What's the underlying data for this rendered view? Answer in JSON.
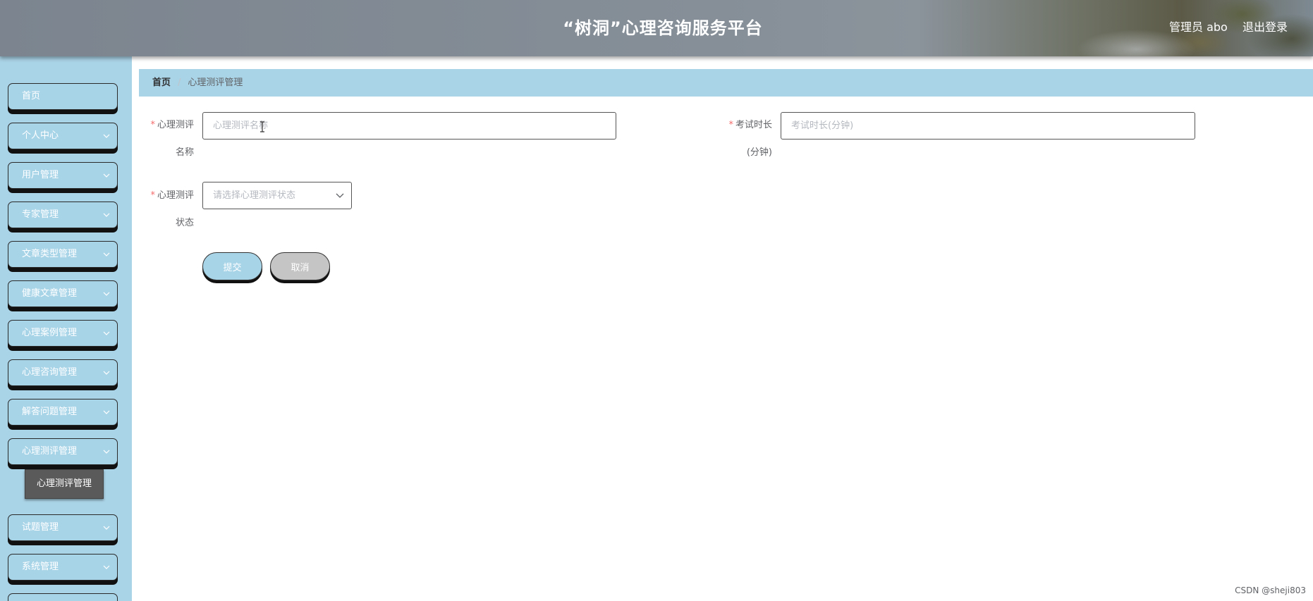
{
  "header": {
    "title": "“树洞”心理咨询服务平台",
    "user_label": "管理员 abo",
    "logout_label": "退出登录"
  },
  "sidebar": {
    "items": [
      {
        "label": "首页",
        "has_chevron": false
      },
      {
        "label": "个人中心",
        "has_chevron": true
      },
      {
        "label": "用户管理",
        "has_chevron": true
      },
      {
        "label": "专家管理",
        "has_chevron": true
      },
      {
        "label": "文章类型管理",
        "has_chevron": true
      },
      {
        "label": "健康文章管理",
        "has_chevron": true
      },
      {
        "label": "心理案例管理",
        "has_chevron": true
      },
      {
        "label": "心理咨询管理",
        "has_chevron": true
      },
      {
        "label": "解答问题管理",
        "has_chevron": true
      },
      {
        "label": "心理测评管理",
        "has_chevron": true,
        "expanded": true
      },
      {
        "label": "试题管理",
        "has_chevron": true
      },
      {
        "label": "系统管理",
        "has_chevron": true
      },
      {
        "label": "",
        "has_chevron": false
      }
    ],
    "active_sub_item": "心理测评管理"
  },
  "breadcrumb": {
    "home": "首页",
    "separator": "/",
    "current": "心理测评管理"
  },
  "form": {
    "name_label_line1": "心理测评",
    "name_label_line2": "名称",
    "name_placeholder": "心理测评名称",
    "name_value": "",
    "duration_label_line1": "考试时长",
    "duration_label_line2": "(分钟)",
    "duration_placeholder": "考试时长(分钟)",
    "duration_value": "",
    "status_label_line1": "心理测评",
    "status_label_line2": "状态",
    "status_placeholder": "请选择心理测评状态",
    "required_mark": "*",
    "submit_label": "提交",
    "cancel_label": "取消"
  },
  "watermark": "CSDN @sheji803",
  "colors": {
    "accent": "#a8d4e8",
    "sidebar_bg": "#a9d3e6",
    "submenu_bg": "#5a5a5a",
    "required": "#f56c6c",
    "cancel_bg": "#c5c5c5"
  }
}
